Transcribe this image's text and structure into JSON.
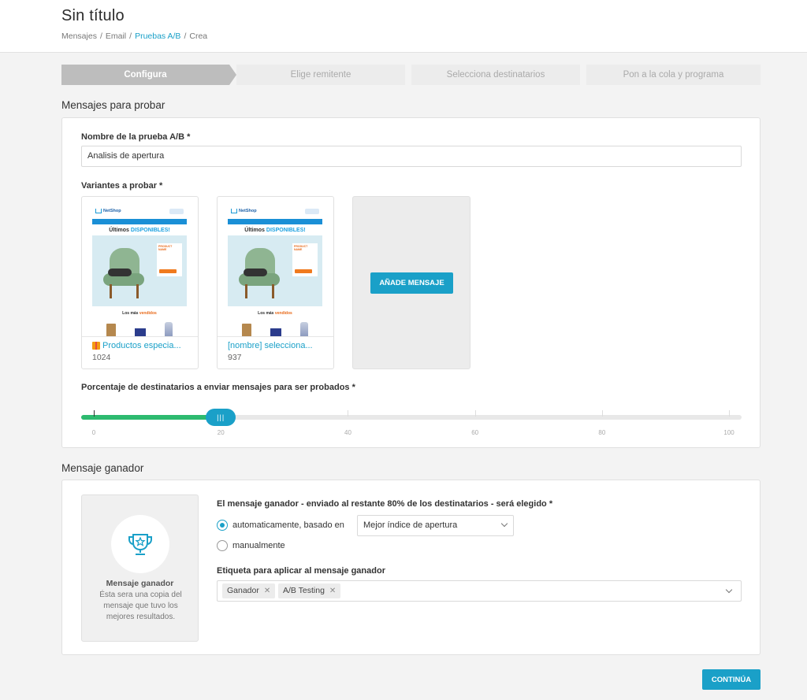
{
  "header": {
    "title": "Sin título",
    "breadcrumb": [
      "Mensajes",
      "Email",
      "Pruebas A/B",
      "Crea"
    ]
  },
  "stepper": {
    "steps": [
      "Configura",
      "Elige remitente",
      "Selecciona destinatarios",
      "Pon a la cola y programa"
    ],
    "active": "Configura"
  },
  "messages_section": {
    "title": "Mensajes para probar",
    "name_label": "Nombre de la prueba A/B *",
    "name_value": "Analisis de apertura",
    "variants_label": "Variantes a probar *",
    "variants": [
      {
        "name": "Productos especia...",
        "count": "1024",
        "icon": "gift-icon"
      },
      {
        "name": "[nombre] selecciona...",
        "count": "937"
      }
    ],
    "preview": {
      "brand": "NetShop",
      "headline_plain": "Últimos",
      "headline_accent": "DISPONIBLES!",
      "product_badge": "PRODUCT NAME",
      "sub_plain": "Los más",
      "sub_accent": "vendidos"
    },
    "add_button": "AÑADE MENSAJE",
    "percentage_label": "Porcentaje de destinatarios a enviar mensajes para ser probados *",
    "slider": {
      "value": 20,
      "min": 0,
      "max": 100,
      "ticks": [
        "0",
        "20",
        "40",
        "60",
        "80",
        "100"
      ],
      "handle_glyph": "|||"
    }
  },
  "winner_section": {
    "title": "Mensaje ganador",
    "box_title": "Mensaje ganador",
    "box_desc": "Ésta sera una copia del mensaje que tuvo los mejores resultados.",
    "question": "El mensaje ganador - enviado al restante 80% de los destinatarios - será elegido *",
    "option_auto": "automaticamente, basado en",
    "option_manual": "manualmente",
    "selected_option": "auto",
    "criteria": "Mejor índice de apertura",
    "tag_label": "Etiqueta para aplicar al mensaje ganador",
    "tags": [
      "Ganador",
      "A/B Testing"
    ],
    "remove_glyph": "✕"
  },
  "footer": {
    "continue": "CONTINÚA"
  },
  "colors": {
    "accent": "#1aa0c8",
    "slider_fill": "#2dba6f",
    "active_step": "#bdbdbd"
  }
}
